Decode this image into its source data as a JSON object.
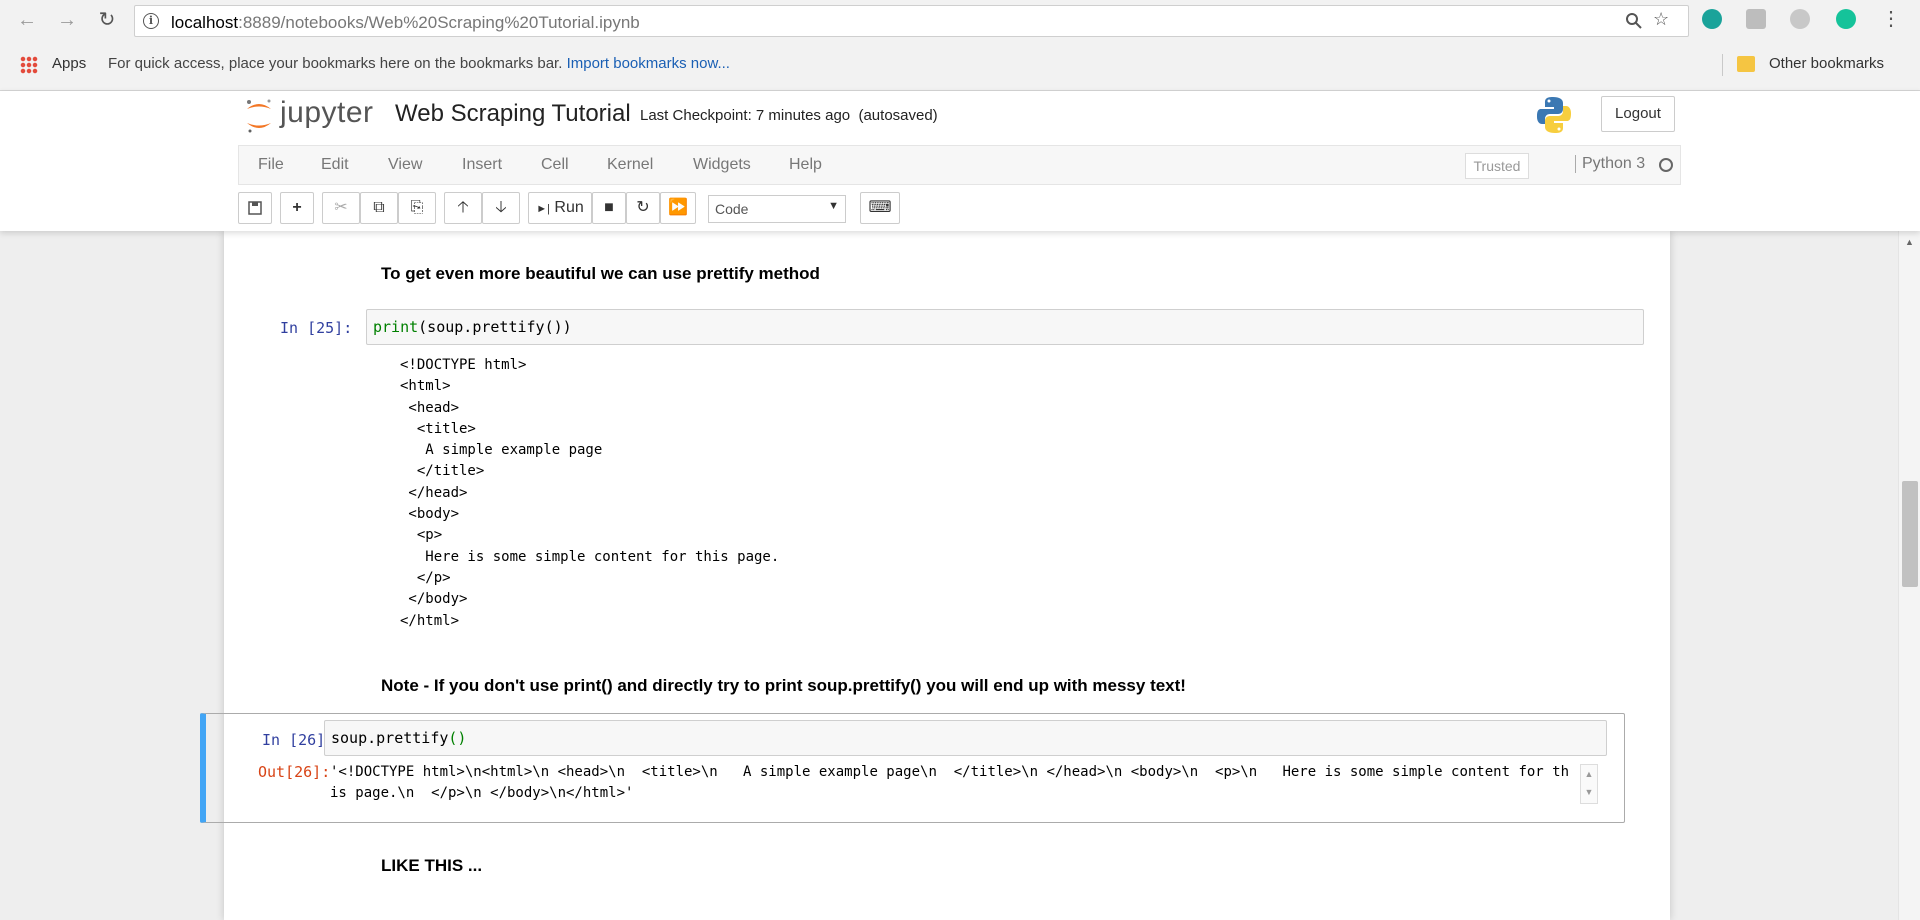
{
  "browser": {
    "url_host": "localhost",
    "url_path": ":8889/notebooks/Web%20Scraping%20Tutorial.ipynb",
    "bookmarks": {
      "apps_label": "Apps",
      "hint": "For quick access, place your bookmarks here on the bookmarks bar.",
      "import_link": "Import bookmarks now...",
      "other_label": "Other bookmarks"
    }
  },
  "jupyter": {
    "logo_text": "jupyter",
    "notebook_name": "Web Scraping Tutorial",
    "checkpoint": "Last Checkpoint: 7 minutes ago",
    "autosave": "(autosaved)",
    "logout_label": "Logout",
    "menu": [
      "File",
      "Edit",
      "View",
      "Insert",
      "Cell",
      "Kernel",
      "Widgets",
      "Help"
    ],
    "trusted_label": "Trusted",
    "kernel_name": "Python 3",
    "toolbar": {
      "run_label": "Run",
      "cell_type": "Code"
    }
  },
  "cells": {
    "md1": "To get even more beautiful we can use prettify method",
    "c25": {
      "prompt": "In [25]:",
      "code_fn": "print",
      "code_rest": "(soup.prettify())",
      "output": "<!DOCTYPE html>\n<html>\n <head>\n  <title>\n   A simple example page\n  </title>\n </head>\n <body>\n  <p>\n   Here is some simple content for this page.\n  </p>\n </body>\n</html>"
    },
    "md2": "Note - If you don't use print() and directly try to print soup.prettify() you will end up with messy text!",
    "c26": {
      "prompt": "In [26]:",
      "code_main": "soup.prettify",
      "code_parens": "()",
      "out_prompt": "Out[26]:",
      "output": "'<!DOCTYPE html>\\n<html>\\n <head>\\n  <title>\\n   A simple example page\\n  </title>\\n </head>\\n <body>\\n  <p>\\n   Here is some simple content for this page.\\n  </p>\\n </body>\\n</html>'"
    },
    "md3": "LIKE THIS ..."
  },
  "colors": {
    "prompt_in": "#303f9f",
    "prompt_out": "#d84315",
    "selected_cell": "#42a5f5"
  }
}
